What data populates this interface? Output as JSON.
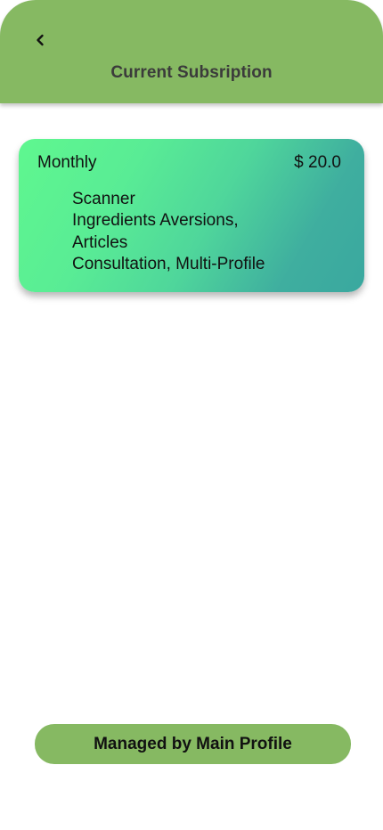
{
  "header": {
    "back_icon": "chevron-left-icon",
    "title": "Current Subsription",
    "bg_color": "#86b962"
  },
  "plan": {
    "name": "Monthly",
    "price": "$ 20.0",
    "features": [
      "Scanner",
      "Ingredients Aversions,",
      "Articles",
      "Consultation, Multi-Profile"
    ],
    "gradient_start": "#5ff78f",
    "gradient_end": "#3aa89f"
  },
  "footer": {
    "button_label": "Managed by Main Profile",
    "button_color": "#86b962"
  }
}
